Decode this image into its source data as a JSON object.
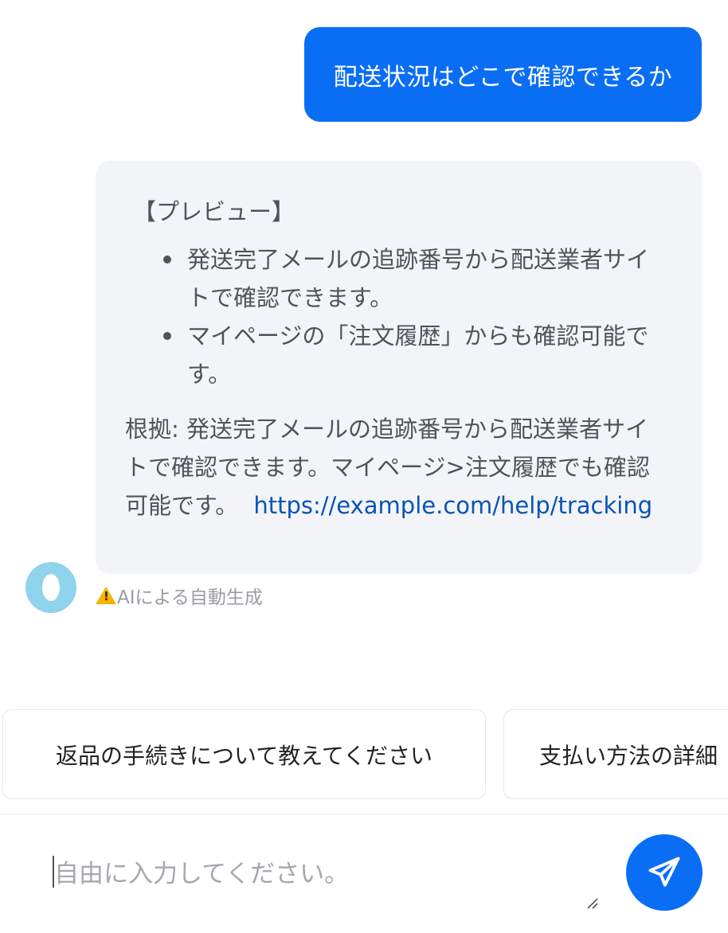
{
  "conversation": {
    "user_message": "配送状況はどこで確認できるか",
    "bot_message": {
      "preview_title": "【プレビュー】",
      "bullets": [
        "発送完了メールの追跡番号から配送業者サイトで確認できます。",
        "マイページの「注文履歴」からも確認可能です。"
      ],
      "basis_text": "根拠: 発送完了メールの追跡番号から配送業者サイトで確認できます。マイページ>注文履歴でも確認可能です。",
      "basis_link": "https://example.com/help/tracking"
    },
    "ai_disclaimer": "AIによる自動生成"
  },
  "suggestions": [
    "返品の手続きについて教えてください",
    "支払い方法の詳細"
  ],
  "composer": {
    "placeholder": "自由に入力してください。"
  },
  "icons": {
    "warning": "warning-icon",
    "send": "paper-plane-icon",
    "avatar": "bot-avatar",
    "resize": "resize-handle-icon"
  },
  "colors": {
    "accent": "#0a6ef5",
    "bot_bubble_bg": "#f3f4f8",
    "link": "#0753b8",
    "avatar": "#8fd3ec",
    "warning": "#f4b400"
  }
}
